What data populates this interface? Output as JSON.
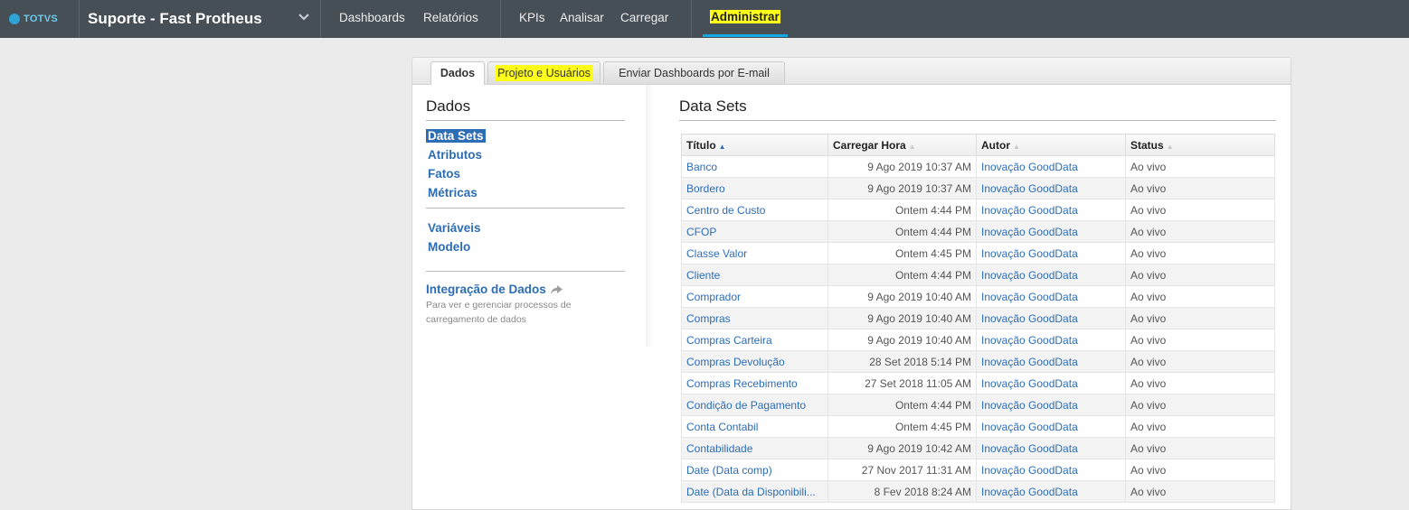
{
  "brand": {
    "logo_text": "TOTVS"
  },
  "project": {
    "name": "Suporte - Fast Protheus"
  },
  "nav": {
    "dashboards": "Dashboards",
    "reports": "Relatórios",
    "kpis": "KPIs",
    "analyze": "Analisar",
    "load": "Carregar",
    "admin": "Administrar"
  },
  "tabs": {
    "data": "Dados",
    "project_users": "Projeto e Usuários",
    "email_dashboards": "Enviar Dashboards por E-mail"
  },
  "sidebar": {
    "title": "Dados",
    "items": [
      "Data Sets",
      "Atributos",
      "Fatos",
      "Métricas"
    ],
    "items2": [
      "Variáveis",
      "Modelo"
    ],
    "integration_title": "Integração de Dados",
    "integration_desc": "Para ver e gerenciar processos de carregamento de dados"
  },
  "main": {
    "title": "Data Sets",
    "columns": {
      "title": "Título",
      "time": "Carregar Hora",
      "author": "Autor",
      "status": "Status"
    },
    "rows": [
      {
        "title": "Banco",
        "time": "9 Ago 2019 10:37 AM",
        "author": "Inovação GoodData",
        "status": "Ao vivo"
      },
      {
        "title": "Bordero",
        "time": "9 Ago 2019 10:37 AM",
        "author": "Inovação GoodData",
        "status": "Ao vivo"
      },
      {
        "title": "Centro de Custo",
        "time": "Ontem 4:44 PM",
        "author": "Inovação GoodData",
        "status": "Ao vivo"
      },
      {
        "title": "CFOP",
        "time": "Ontem 4:44 PM",
        "author": "Inovação GoodData",
        "status": "Ao vivo"
      },
      {
        "title": "Classe Valor",
        "time": "Ontem 4:45 PM",
        "author": "Inovação GoodData",
        "status": "Ao vivo"
      },
      {
        "title": "Cliente",
        "time": "Ontem 4:44 PM",
        "author": "Inovação GoodData",
        "status": "Ao vivo"
      },
      {
        "title": "Comprador",
        "time": "9 Ago 2019 10:40 AM",
        "author": "Inovação GoodData",
        "status": "Ao vivo"
      },
      {
        "title": "Compras",
        "time": "9 Ago 2019 10:40 AM",
        "author": "Inovação GoodData",
        "status": "Ao vivo"
      },
      {
        "title": "Compras Carteira",
        "time": "9 Ago 2019 10:40 AM",
        "author": "Inovação GoodData",
        "status": "Ao vivo"
      },
      {
        "title": "Compras Devolução",
        "time": "28 Set 2018 5:14 PM",
        "author": "Inovação GoodData",
        "status": "Ao vivo"
      },
      {
        "title": "Compras Recebimento",
        "time": "27 Set 2018 11:05 AM",
        "author": "Inovação GoodData",
        "status": "Ao vivo"
      },
      {
        "title": "Condição de Pagamento",
        "time": "Ontem 4:44 PM",
        "author": "Inovação GoodData",
        "status": "Ao vivo"
      },
      {
        "title": "Conta Contabil",
        "time": "Ontem 4:45 PM",
        "author": "Inovação GoodData",
        "status": "Ao vivo"
      },
      {
        "title": "Contabilidade",
        "time": "9 Ago 2019 10:42 AM",
        "author": "Inovação GoodData",
        "status": "Ao vivo"
      },
      {
        "title": "Date (Data comp)",
        "time": "27 Nov 2017 11:31 AM",
        "author": "Inovação GoodData",
        "status": "Ao vivo"
      },
      {
        "title": "Date (Data da Disponibili...",
        "time": "8 Fev 2018 8:24 AM",
        "author": "Inovação GoodData",
        "status": "Ao vivo"
      }
    ]
  },
  "colors": {
    "topbar": "#464e56",
    "accent": "#14a8e4",
    "link": "#2c6db4",
    "highlight": "#ffff19"
  }
}
